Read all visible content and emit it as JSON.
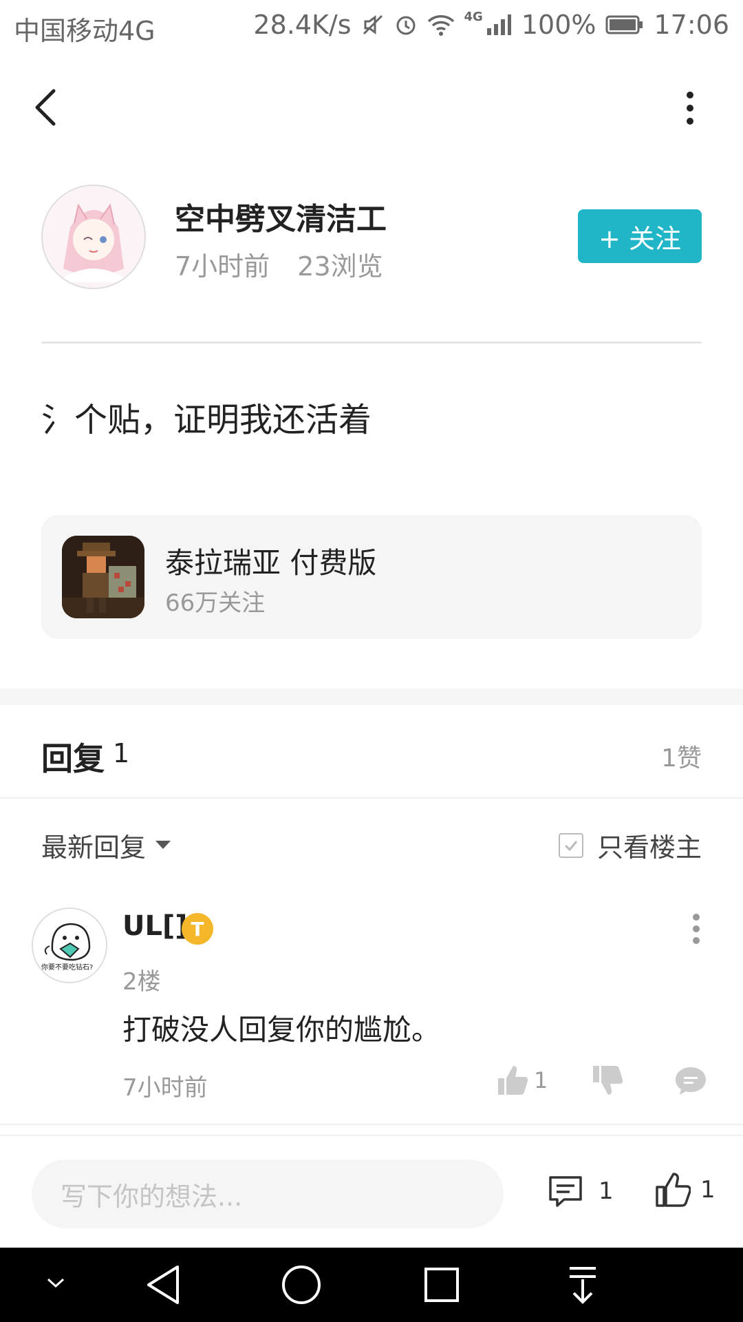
{
  "status_bar": {
    "carrier": "中国移动4G",
    "speed": "28.4K/s",
    "network": "4G",
    "battery": "100%",
    "time": "17:06"
  },
  "header": {
    "back_icon": "chevron-left-icon",
    "more_icon": "vertical-ellipsis-icon"
  },
  "author": {
    "name": "空中劈叉清洁工",
    "time": "7小时前",
    "views": "23浏览",
    "follow_label": "+ 关注",
    "follow_color": "#20b6c7"
  },
  "post": {
    "text": "氵个贴，证明我还活着"
  },
  "game": {
    "name": "泰拉瑞亚 付费版",
    "followers": "66万关注"
  },
  "replies": {
    "title": "回复",
    "count": "1",
    "likes": "1赞",
    "sort_label": "最新回复",
    "only_op_label": "只看楼主"
  },
  "comments": [
    {
      "user": "UL[]",
      "badge": "T",
      "floor": "2楼",
      "text": "打破没人回复你的尴尬。",
      "time": "7小时前",
      "likes": "1",
      "avatar_caption": "你要不要吃钻石?"
    }
  ],
  "bottom_bar": {
    "input_placeholder": "写下你的想法...",
    "comment_count": "1",
    "like_count": "1"
  },
  "nav_bar": {
    "items": [
      "chevron-down-icon",
      "back-triangle-icon",
      "home-circle-icon",
      "recents-square-icon",
      "notification-pull-icon"
    ]
  }
}
